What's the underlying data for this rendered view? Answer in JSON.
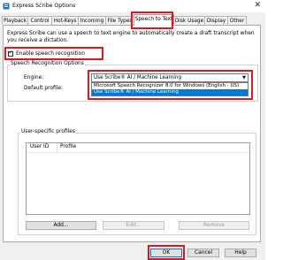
{
  "window": {
    "title": "Express Scribe Options",
    "close_glyph": "✕"
  },
  "tabs": [
    "Playback",
    "Control",
    "Hot-Keys",
    "Incoming",
    "File Types",
    "Speech to Text",
    "Disk Usage",
    "Display",
    "Other"
  ],
  "active_tab": "Speech to Text",
  "description": "Express Scribe can use a speech to text engine to automatically create a draft transcript when you receive a dictation.",
  "enable_checkbox": {
    "label": "Enable speech recognition",
    "checked": true
  },
  "speech_options": {
    "group_label": "Speech Recognition Options",
    "engine_label": "Engine:",
    "engine_value": "Use Scribe® AI / Machine Learning",
    "default_profile_label": "Default profile:",
    "dropdown_options": [
      "Microsoft Speech Recognizer 8.0 for Windows (English - US)",
      "Use Scribe® AI / Machine Learning"
    ],
    "selected_option_index": 1
  },
  "user_profiles": {
    "group_label": "User-specific profiles",
    "columns": [
      "User ID",
      "Profile"
    ],
    "add_label": "Add...",
    "edit_label": "Edit...",
    "remove_label": "Remove"
  },
  "footer": {
    "ok_label": "OK",
    "cancel_label": "Cancel",
    "help_label": "Help"
  },
  "colors": {
    "highlight": "#e0161d",
    "selection": "#0078d7",
    "dialog_bg": "#f0f0f0"
  }
}
